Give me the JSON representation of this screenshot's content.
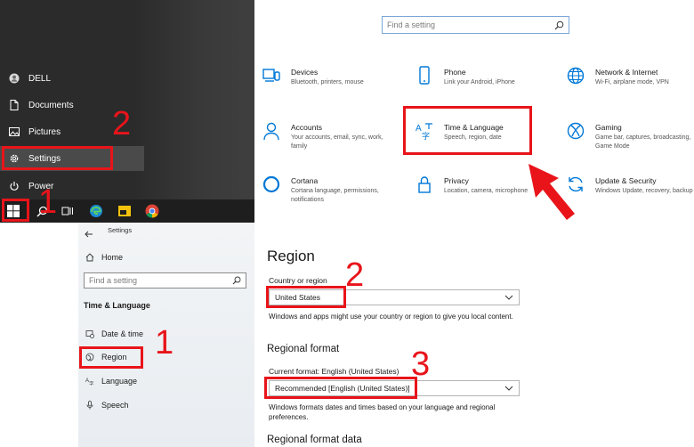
{
  "start_menu": {
    "items": [
      {
        "label": "DELL",
        "icon": "user-icon"
      },
      {
        "label": "Documents",
        "icon": "document-icon"
      },
      {
        "label": "Pictures",
        "icon": "picture-icon"
      },
      {
        "label": "Settings",
        "icon": "gear-icon"
      },
      {
        "label": "Power",
        "icon": "power-icon"
      }
    ]
  },
  "taskbar": {
    "icons": [
      "windows-start-icon",
      "search-icon",
      "task-view-icon",
      "edge-icon",
      "file-explorer-icon",
      "chrome-icon"
    ]
  },
  "settings_home": {
    "search_placeholder": "Find a setting",
    "tiles": [
      {
        "title": "Devices",
        "desc": "Bluetooth, printers, mouse",
        "icon": "devices-icon"
      },
      {
        "title": "Phone",
        "desc": "Link your Android, iPhone",
        "icon": "phone-icon"
      },
      {
        "title": "Network & Internet",
        "desc": "Wi-Fi, airplane mode, VPN",
        "icon": "globe-icon"
      },
      {
        "title": "Accounts",
        "desc": "Your accounts, email, sync, work, family",
        "icon": "account-icon"
      },
      {
        "title": "Time & Language",
        "desc": "Speech, region, date",
        "icon": "time-language-icon"
      },
      {
        "title": "Gaming",
        "desc": "Game bar, captures, broadcasting, Game Mode",
        "icon": "xbox-icon"
      },
      {
        "title": "Cortana",
        "desc": "Cortana language, permissions, notifications",
        "icon": "cortana-icon"
      },
      {
        "title": "Privacy",
        "desc": "Location, camera, microphone",
        "icon": "lock-icon"
      },
      {
        "title": "Update & Security",
        "desc": "Windows Update, recovery, backup",
        "icon": "update-icon"
      }
    ]
  },
  "settings_nav": {
    "window_title": "Settings",
    "home_label": "Home",
    "search_placeholder": "Find a setting",
    "section_title": "Time & Language",
    "items": [
      {
        "label": "Date & time",
        "icon": "calendar-clock-icon"
      },
      {
        "label": "Region",
        "icon": "region-icon"
      },
      {
        "label": "Language",
        "icon": "language-icon"
      },
      {
        "label": "Speech",
        "icon": "microphone-icon"
      }
    ]
  },
  "region": {
    "title": "Region",
    "country_label": "Country or region",
    "country_value": "United States",
    "country_help": "Windows and apps might use your country or region to give you local content.",
    "format_heading": "Regional format",
    "current_format": "Current format: English (United States)",
    "format_value": "Recommended [English (United States)]",
    "format_help": "Windows formats dates and times based on your language and regional preferences.",
    "format_data_heading": "Regional format data"
  },
  "annotations": {
    "num_start_1": "1",
    "num_start_2": "2",
    "num_nav_1": "1",
    "num_region_2": "2",
    "num_region_3": "3"
  },
  "colors": {
    "accent": "#0078d7",
    "annotation_red": "#e8141a"
  }
}
